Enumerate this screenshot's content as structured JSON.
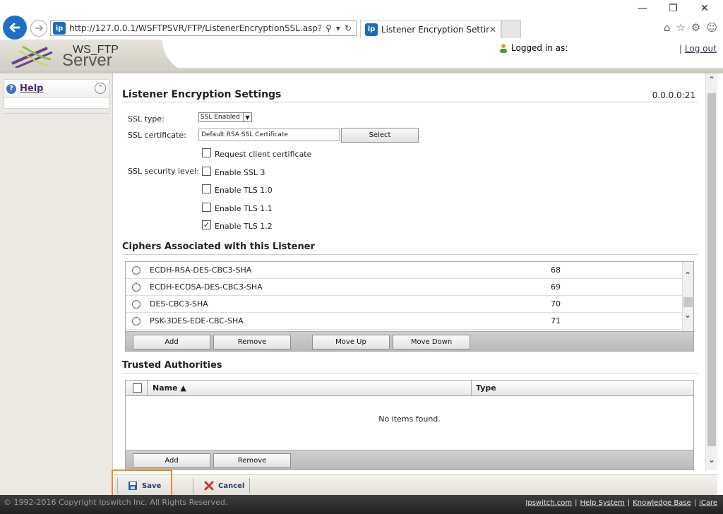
{
  "browser": {
    "url": "http://127.0.0.1/WSFTPSVR/FTP/ListenerEncryptionSSL.asp?Respon:",
    "tab_title": "Listener Encryption Settings...",
    "site_icon_text": "ip"
  },
  "header": {
    "logo_line1": "WS_FTP",
    "logo_line2": "Server",
    "logged_in_label": "Logged in as:",
    "logout_label": "Log out",
    "logout_sep": "|"
  },
  "sidebar": {
    "help_label": "Help"
  },
  "main": {
    "title": "Listener Encryption Settings",
    "listener_id": "0.0.0.0:21",
    "ssl_type_label": "SSL type:",
    "ssl_type_value": "SSL Enabled",
    "ssl_cert_label": "SSL certificate:",
    "ssl_cert_value": "Default RSA SSL Certificate",
    "select_button": "Select",
    "request_client_cert": "Request client certificate",
    "ssl_security_label": "SSL security level:",
    "security_options": [
      {
        "label": "Enable SSL 3",
        "checked": false
      },
      {
        "label": "Enable TLS 1.0",
        "checked": false
      },
      {
        "label": "Enable TLS 1.1",
        "checked": false
      },
      {
        "label": "Enable TLS 1.2",
        "checked": true
      }
    ],
    "ciphers_title": "Ciphers Associated with this Listener",
    "ciphers": [
      {
        "name": "ECDH-RSA-DES-CBC3-SHA",
        "value": "68"
      },
      {
        "name": "ECDH-ECDSA-DES-CBC3-SHA",
        "value": "69"
      },
      {
        "name": "DES-CBC3-SHA",
        "value": "70"
      },
      {
        "name": "PSK-3DES-EDE-CBC-SHA",
        "value": "71"
      }
    ],
    "cipher_buttons": {
      "add": "Add",
      "remove": "Remove",
      "move_up": "Move Up",
      "move_down": "Move Down"
    },
    "trusted_title": "Trusted Authorities",
    "trusted_columns": {
      "name": "Name ▲",
      "type": "Type"
    },
    "trusted_empty": "No items found.",
    "trusted_buttons": {
      "add": "Add",
      "remove": "Remove"
    }
  },
  "footer": {
    "save": "Save",
    "cancel": "Cancel"
  },
  "status": {
    "copyright": "© 1992-2016 Copyright Ipswitch Inc. All Rights Reserved.",
    "links": [
      "Ipswitch.com",
      "Help System",
      "Knowledge Base",
      "iCare"
    ]
  },
  "colors": {
    "save_highlight": "#f08a24",
    "link": "#3a2f5b"
  }
}
